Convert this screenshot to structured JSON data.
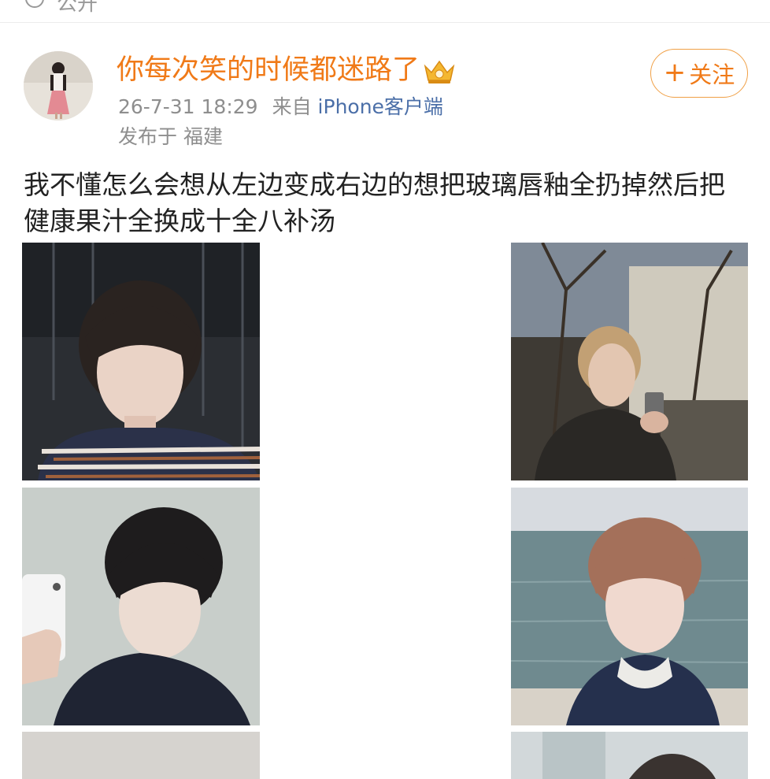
{
  "header": {
    "visibility_label": "公开"
  },
  "post": {
    "username": "你每次笑的时候都迷路了",
    "follow_button": {
      "plus": "+",
      "label": "关注"
    },
    "time": "26-7-31 18:29",
    "source_prefix": "来自",
    "source": "iPhone客户端",
    "location": "发布于 福建",
    "text": "我不懂怎么会想从左边变成右边的想把玻璃唇釉全扔掉然后把健康果汁全换成十全八补汤",
    "photos": [
      {
        "icon": "photo-boy-striped-shirt"
      },
      {
        "icon": "photo-boy-night-street-phone"
      },
      {
        "icon": "photo-boy-mirror-selfie"
      },
      {
        "icon": "photo-boy-seaside"
      },
      {
        "icon": "photo-partial"
      },
      {
        "icon": "photo-partial"
      }
    ]
  },
  "colors": {
    "username": "#f07a18",
    "follow_border": "#f0a046",
    "meta": "#8e8e8e",
    "source_link": "#4b6fa8",
    "body_text": "#222222"
  }
}
